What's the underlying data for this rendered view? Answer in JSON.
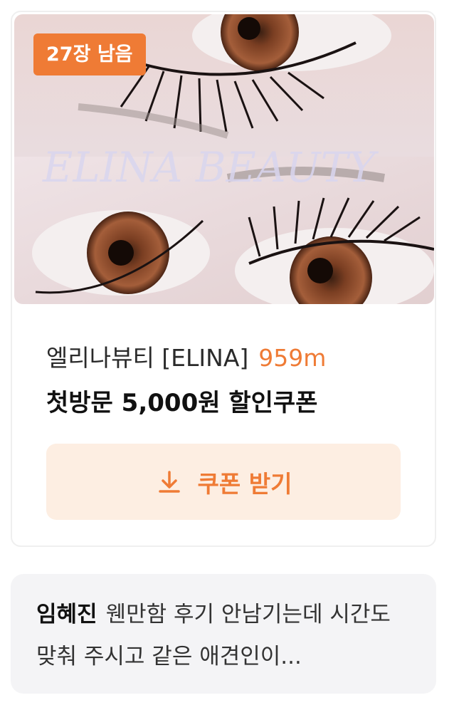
{
  "badge": {
    "remaining": "27장 남음"
  },
  "photo": {
    "watermark": "ELINA BEAUTY"
  },
  "shop": {
    "name": "엘리나뷰티 [ELINA]",
    "distance": "959m"
  },
  "coupon": {
    "title": "첫방문 5,000원 할인쿠폰"
  },
  "button": {
    "label": "쿠폰 받기",
    "icon": "download-icon"
  },
  "review": {
    "author": "임혜진",
    "text": "웬만함 후기 안남기는데 시간도 맞춰 주시고 같은 애견인이..."
  },
  "colors": {
    "accent": "#ef7b35",
    "button_bg": "#fdeee2",
    "review_bg": "#f4f4f6"
  }
}
